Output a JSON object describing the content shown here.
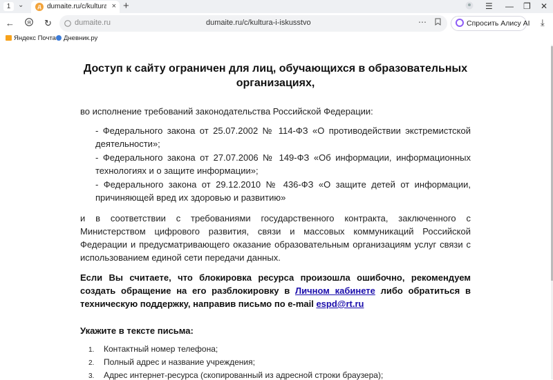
{
  "browser": {
    "tab_counter": "1",
    "tab_title": "dumaite.ru/c/kultura-i-i",
    "favicon_letter": "д",
    "address_domain": "dumaite.ru",
    "address_url": "dumaite.ru/c/kultura-i-iskusstvo",
    "alice_label": "Спросить Алису AI",
    "bookmarks": [
      "Яндекс Почта",
      "Дневник.ру"
    ]
  },
  "content": {
    "heading": "Доступ к сайту ограничен для лиц, обучающихся в образовательных организациях,",
    "intro": "во исполнение требований законодательства Российской Федерации:",
    "laws": [
      "- Федерального закона от 25.07.2002 № 114-ФЗ «О противодействии экстремистской деятельности»;",
      "- Федерального закона от 27.07.2006 № 149-ФЗ «Об информации, информационных технологиях и о защите информации»;",
      "- Федерального закона от 29.12.2010 № 436-ФЗ «О защите детей от информации, причиняющей вред их здоровью и развитию»"
    ],
    "contract": "и в соответствии с требованиями государственного контракта, заключенного с Министерством цифрового развития, связи и массовых коммуникаций Российской Федерации и предусматривающего оказание образовательным организациям услуг связи с использованием единой сети передачи данных.",
    "notice_before": "Если Вы считаете, что блокировка ресурса произошла ошибочно, рекомендуем создать обращение на его разблокировку в ",
    "notice_link": "Личном кабинете",
    "notice_middle": " либо обратиться в техническую поддержку, направив письмо по e-mail ",
    "notice_email": "espd@rt.ru",
    "instructions_title": "Укажите в тексте письма:",
    "instructions": [
      "Контактный номер телефона;",
      "Полный адрес и название учреждения;",
      "Адрес интернет-ресурса (скопированный из адресной строки браузера);"
    ]
  }
}
